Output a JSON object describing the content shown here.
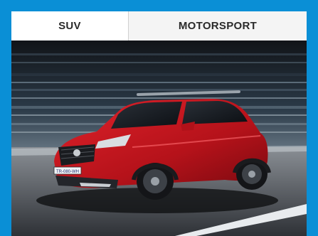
{
  "tabs": [
    {
      "label": "SUV",
      "active": true
    },
    {
      "label": "MOTORSPORT",
      "active": false
    }
  ],
  "hero": {
    "plate_text": "TR-080-WH",
    "car_color": "#c8141c",
    "frame_color": "#0a8fd6"
  }
}
